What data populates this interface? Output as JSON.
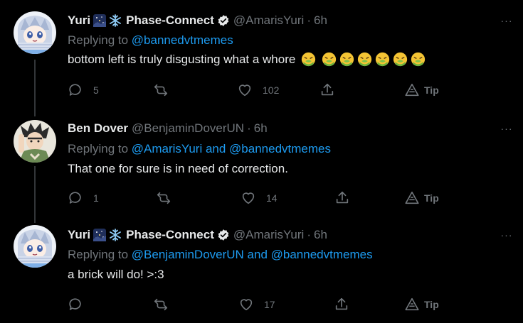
{
  "tweets": [
    {
      "display_name": "Yuri",
      "org_name": "Phase-Connect",
      "handle": "@AmarisYuri",
      "time": "6h",
      "replying_prefix": "Replying to",
      "mention_1": "@bannedvtmemes",
      "mention_join": "",
      "mention_2": "",
      "text": "bottom left is truly disgusting what a whore",
      "emoji_count": 7,
      "replies": "5",
      "retweets": "",
      "likes": "102",
      "tip_label": "Tip",
      "more_label": "···"
    },
    {
      "display_name": "Ben Dover",
      "org_name": "",
      "handle": "@BenjaminDoverUN",
      "time": "6h",
      "replying_prefix": "Replying to",
      "mention_1": "@AmarisYuri",
      "mention_join": "and",
      "mention_2": "@bannedvtmemes",
      "text": "That one for sure is in need of correction.",
      "emoji_count": 0,
      "replies": "1",
      "retweets": "",
      "likes": "14",
      "tip_label": "Tip",
      "more_label": "···"
    },
    {
      "display_name": "Yuri",
      "org_name": "Phase-Connect",
      "handle": "@AmarisYuri",
      "time": "6h",
      "replying_prefix": "Replying to",
      "mention_1": "@BenjaminDoverUN",
      "mention_join": "and",
      "mention_2": "@bannedvtmemes",
      "text": "a brick will do! >:3",
      "emoji_count": 0,
      "replies": "",
      "retweets": "",
      "likes": "17",
      "tip_label": "Tip",
      "more_label": "···"
    }
  ],
  "colors": {
    "background": "#000000",
    "text_primary": "#e7e9ea",
    "text_secondary": "#71767b",
    "link": "#1d9bf0",
    "thread_line": "#333639"
  },
  "icons": {
    "reply": "reply-bubble-icon",
    "retweet": "retweet-icon",
    "like": "heart-icon",
    "share": "share-icon",
    "tip": "tip-icon",
    "verified": "verified-badge-icon",
    "sick_emoji": "nauseated-face-emoji"
  }
}
